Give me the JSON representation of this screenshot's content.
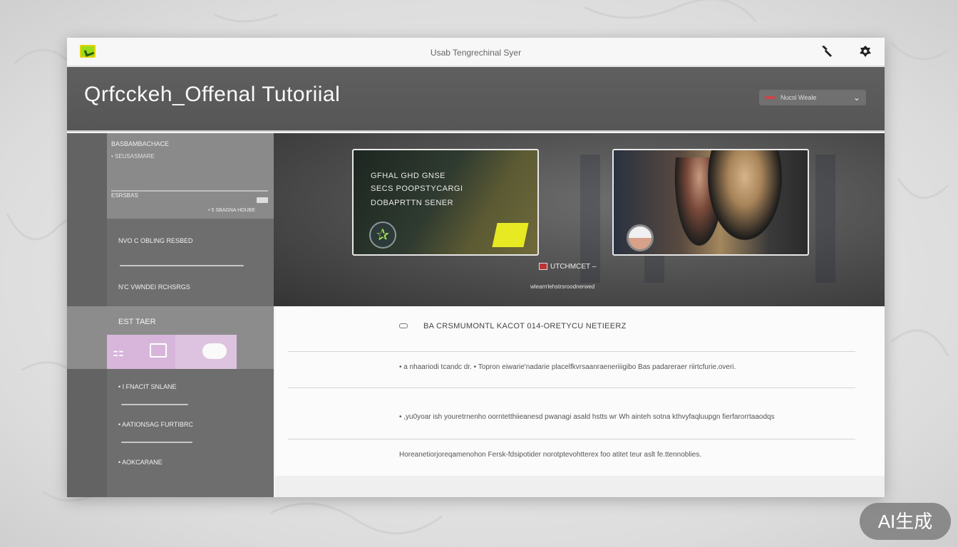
{
  "window": {
    "title": "Usab Tengrechinal Syer"
  },
  "header": {
    "title": "Qrfcckeh_Offenal Tutoriial",
    "language": "Nucsl Weale"
  },
  "sidebar": {
    "block_top": {
      "line1": "BASBAMBACHACE",
      "line2": "• SEUSASMARE",
      "line3": "ESRSBAS",
      "line4": "• 5 SBAGNA HOUBE"
    },
    "items": [
      {
        "label": "NVO C OBLING RESBED"
      },
      {
        "label": "N'C VWNDEI RCHSRGS"
      },
      {
        "label": "• I FNACIT SNLANE"
      },
      {
        "label": "• AATIONSAG FURTIBRC"
      },
      {
        "label": "• AOKCARANE"
      }
    ],
    "section_label": "EST TAER"
  },
  "hero": {
    "card_left_lines": [
      "GFHAL GHD GNSE",
      "SECS POOPSTYCARGI",
      "DOBAPRTTN SENER"
    ],
    "caption": "UTCHMCET",
    "subcaption": "wlearrrlehstrsroodnerwed"
  },
  "content": {
    "heading": "BA CRSMUMONTL KACOT 014-ORETYCU NETIEERZ",
    "rows": [
      "• a nhaariodi tcandc dr.   •  Topron eiwarie'nadarie placelfkvrsaanraeneriiigibo Bas padareraer riirtcfurie.overi.",
      "•  ,yu0yoar ish youretrnenho oorntetthiieanesd pwanagi asald hstts wr Wh ainteh   sotna kthvyfaqluupgn fierfarorrtaaodqs",
      "Horeanetiorjoreqamenohon Fersk-fdsipotider norotptevohtterex foo atitet teur aslt fe.ttennoblies."
    ]
  },
  "badge": {
    "text": "AI生成"
  },
  "icons": {
    "app": "app-logo-icon",
    "tool": "wrench-icon",
    "settings": "gear-icon",
    "dropdown": "chevron-down-icon"
  },
  "colors": {
    "accent_green": "#9bdc1a",
    "accent_yellow": "#e7ea23",
    "header_bg": "#5a5a5a",
    "sidebar_bg": "#6e6e6e",
    "tile_pink": "#d8b6dc"
  }
}
